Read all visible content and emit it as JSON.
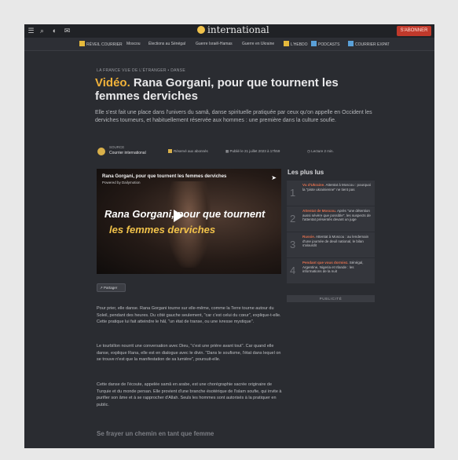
{
  "topbar": {
    "logo_text": "international",
    "subscribe_label": "S'ABONNER"
  },
  "nav": {
    "items": [
      "RÉVEIL COURRIER",
      "Moscou",
      "Élections au Sénégal",
      "Guerre Israël-Hamas",
      "Guerre en Ukraine",
      "L'HEBDO",
      "PODCASTS",
      "COURRIER EXPAT"
    ]
  },
  "article": {
    "kicker": "LA FRANCE VUE DE L'ÉTRANGER • DANSE",
    "title_prefix": "Vidéo.",
    "title": "Rana Gorgani, pour que tournent les femmes derviches",
    "lede": "Elle s'est fait une place dans l'univers du samâ, danse spirituelle pratiquée par ceux qu'on appelle en Occident les derviches tourneurs, et habituellement réservée aux hommes : une première dans la culture soufie.",
    "source_label": "SOURCE",
    "source_name": "Courrier international",
    "reserved": "Réservé aux abonnés",
    "published": "Publié le 21 juillet 2023 à 17h59",
    "reading_time": "Lecture 2 min."
  },
  "video": {
    "title": "Rana Gorgani, pour que tournent les femmes derviches",
    "byline": "Powered by Dailymotion",
    "overlay_line1": "Rana Gorgani, pour que tournent",
    "overlay_line2": "les femmes derviches"
  },
  "share": {
    "label": "Partager"
  },
  "body": {
    "p1": "Pour prier, elle danse. Rana Gorgani tourne sur elle-même, comme la Terre tourne autour du Soleil, pendant des heures. Du côté gauche seulement, \"car c'est celui du cœur\", explique-t-elle. Cette pratique lui fait atteindre le hâl, \"un état de transe, ou une ivresse mystique\".",
    "p2": "Le tourbillon nourrit une conversation avec Dieu, \"c'est une prière avant tout\". Car quand elle danse, explique Rana, elle est en dialogue avec le divin. \"Dans le soufisme, l'état dans lequel on se trouve n'est que la manifestation de sa lumière\", poursuit-elle.",
    "p3": "Cette danse de l'écoute, appelée samâ en arabe, est une chorégraphie sacrée originaire de Turquie et du monde persan. Elle provient d'une branche ésotérique de l'islam soufie, qui invite à purifier son âme et à se rapprocher d'Allah. Seuls les hommes sont autorisés à la pratiquer en public.",
    "subhead": "Se frayer un chemin en tant que femme"
  },
  "sidebar": {
    "title": "Les plus lus",
    "items": [
      {
        "num": "1",
        "highlight": "Vu d'Ukraine.",
        "text": "Attentat à Moscou : pourquoi la \"piste ukrainienne\" ne tient pas"
      },
      {
        "num": "2",
        "highlight": "Attentat de Moscou.",
        "text": "Après \"une détention aussi sévère que possible\", les suspects de l'attentat présentés devant un juge"
      },
      {
        "num": "3",
        "highlight": "Russie.",
        "text": "Attentat à Moscou : au lendemain d'une journée de deuil national, le bilan s'alourdit"
      },
      {
        "num": "4",
        "highlight": "Pendant que vous dormiez.",
        "text": "Sénégal, Argentine, Nigeria et Irlande : les informations de la nuit"
      }
    ],
    "pub_label": "PUBLICITÉ"
  }
}
